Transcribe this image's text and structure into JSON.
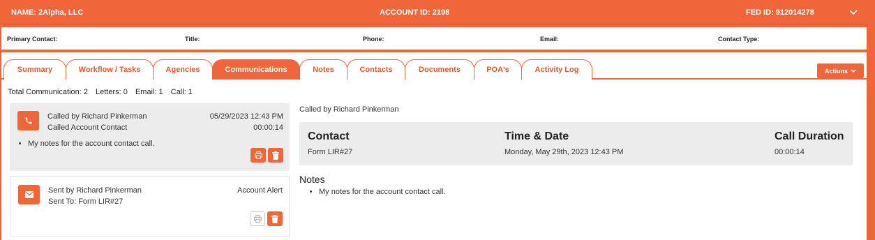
{
  "header": {
    "name": "NAME: 2Alpha, LLC",
    "account_id": "ACCOUNT ID: 2198",
    "fed_id": "FED ID: 912014278",
    "toggle_icon": "chevron-down-icon"
  },
  "contact_bar": {
    "primary_contact": "Primary Contact:",
    "title": "Title:",
    "phone": "Phone:",
    "email": "Email:",
    "contact_type": "Contact Type:"
  },
  "tabs": [
    {
      "label": "Summary"
    },
    {
      "label": "Workflow / Tasks"
    },
    {
      "label": "Agencies"
    },
    {
      "label": "Communications",
      "active": true
    },
    {
      "label": "Notes"
    },
    {
      "label": "Contacts"
    },
    {
      "label": "Documents"
    },
    {
      "label": "POA's"
    },
    {
      "label": "Activity Log"
    }
  ],
  "actions_label": "Actions",
  "summary": {
    "total": "Total Communication: 2",
    "letters": "Letters: 0",
    "email": "Email: 1",
    "call": "Call: 1"
  },
  "communications": [
    {
      "type_icon": "phone-icon",
      "line1": "Called by Richard Pinkerman",
      "line2": "Called Account Contact",
      "date": "05/29/2023 12:43 PM",
      "duration": "00:00:14",
      "note": "My notes for the account contact call."
    },
    {
      "type_icon": "mail-icon",
      "line1": "Sent by Richard Pinkerman",
      "line2": "Sent To: Form LIR#27",
      "right_label": "Account Alert"
    }
  ],
  "detail": {
    "title": "Called by Richard Pinkerman",
    "contact_header": "Contact",
    "contact_value": "Form LIR#27",
    "time_header": "Time & Date",
    "time_value": "Monday, May 29th, 2023 12:43 PM",
    "duration_header": "Call Duration",
    "duration_value": "00:00:14",
    "notes_header": "Notes",
    "notes": [
      "My notes for the account contact call."
    ]
  },
  "colors": {
    "accent": "#f0653a",
    "card_bg": "#ececec"
  }
}
